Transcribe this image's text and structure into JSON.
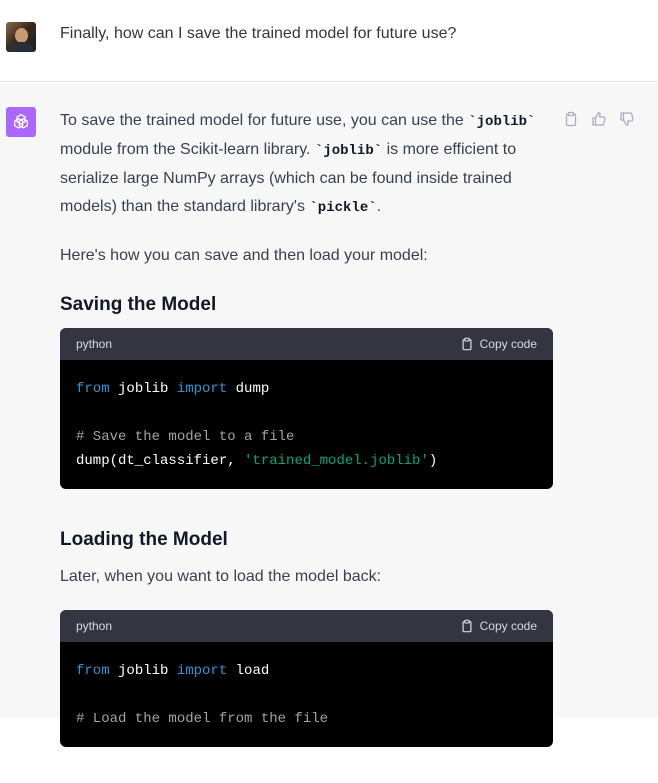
{
  "user": {
    "avatar_icon": "user-photo-avatar",
    "message": "Finally, how can I save the trained model for future use?"
  },
  "assistant": {
    "avatar_icon": "openai-logo-icon",
    "avatar_color": "#ab68ff",
    "actions": {
      "copy_icon": "clipboard-icon",
      "like_icon": "thumbs-up-icon",
      "dislike_icon": "thumbs-down-icon"
    },
    "p1": {
      "t1": "To save the trained model for future use, you can use the ",
      "c1": "`joblib`",
      "t2": " module from the Scikit-learn library. ",
      "c2": "`joblib`",
      "t3": " is more efficient to serialize large NumPy arrays (which can be found inside trained models) than the standard library's ",
      "c3": "`pickle`",
      "t4": "."
    },
    "p2": "Here's how you can save and then load your model:",
    "section1": {
      "heading": "Saving the Model",
      "code": {
        "language": "python",
        "copy_label": "Copy code",
        "l1": {
          "kw1": "from",
          "t1": " joblib ",
          "kw2": "import",
          "t2": " dump"
        },
        "l3": "# Save the model to a file",
        "l4": {
          "t1": "dump(dt_classifier, ",
          "str": "'trained_model.joblib'",
          "t2": ")"
        }
      }
    },
    "section2": {
      "heading": "Loading the Model",
      "intro": "Later, when you want to load the model back:",
      "code": {
        "language": "python",
        "copy_label": "Copy code",
        "l1": {
          "kw1": "from",
          "t1": " joblib ",
          "kw2": "import",
          "t2": " load"
        },
        "l3": "# Load the model from the file"
      }
    }
  },
  "colors": {
    "keyword": "#2e95d3",
    "comment": "#a3a3a3",
    "string": "#00a67d",
    "code_bg": "#000000",
    "code_header_bg": "#343541"
  }
}
